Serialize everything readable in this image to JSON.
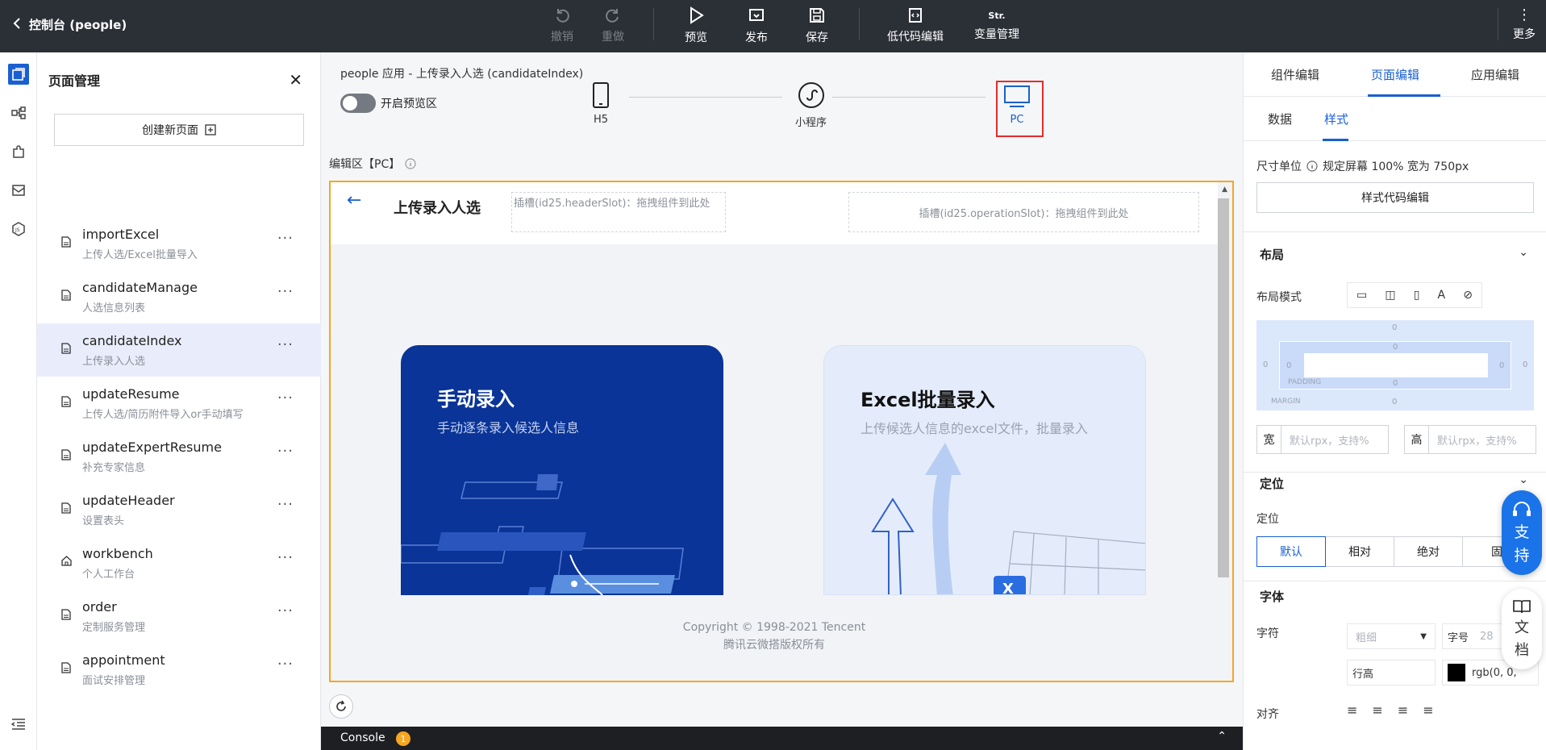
{
  "topbar": {
    "back_title": "控制台 (people)",
    "undo": "撤销",
    "redo": "重做",
    "preview": "预览",
    "publish": "发布",
    "save": "保存",
    "lowcode": "低代码编辑",
    "var_icon": "Str.",
    "variables": "变量管理",
    "more": "更多"
  },
  "page_panel": {
    "title": "页面管理",
    "create": "创建新页面",
    "pages": [
      {
        "name": "importExcel",
        "desc": "上传人选/Excel批量导入",
        "icon": "file-icon",
        "active": false
      },
      {
        "name": "candidateManage",
        "desc": "人选信息列表",
        "icon": "file-icon",
        "active": false
      },
      {
        "name": "candidateIndex",
        "desc": "上传录入人选",
        "icon": "file-icon",
        "active": true
      },
      {
        "name": "updateResume",
        "desc": "上传人选/简历附件导入or手动填写",
        "icon": "file-icon",
        "active": false
      },
      {
        "name": "updateExpertResume",
        "desc": "补充专家信息",
        "icon": "file-icon",
        "active": false
      },
      {
        "name": "updateHeader",
        "desc": "设置表头",
        "icon": "file-icon",
        "active": false
      },
      {
        "name": "workbench",
        "desc": "个人工作台",
        "icon": "home-icon",
        "active": false
      },
      {
        "name": "order",
        "desc": "定制服务管理",
        "icon": "file-icon",
        "active": false
      },
      {
        "name": "appointment",
        "desc": "面试安排管理",
        "icon": "file-icon",
        "active": false
      }
    ]
  },
  "editor": {
    "app_title": "people 应用 - 上传录入人选 (candidateIndex)",
    "preview_toggle": "开启预览区",
    "devices": {
      "h5": "H5",
      "mini": "小程序",
      "pc": "PC"
    },
    "edit_label": "编辑区【PC】",
    "canvas": {
      "title": "上传录入人选",
      "header_slot": "插槽(id25.headerSlot)：拖拽组件到此处",
      "operation_slot": "插槽(id25.operationSlot)：拖拽组件到此处",
      "card_manual_title": "手动录入",
      "card_manual_sub": "手动逐条录入候选人信息",
      "card_excel_title": "Excel批量录入",
      "card_excel_sub": "上传候选人信息的excel文件，批量录入",
      "copyright_1": "Copyright © 1998-2021 Tencent",
      "copyright_2": "腾讯云微搭版权所有"
    }
  },
  "console": {
    "label": "Console",
    "badge": "1"
  },
  "right_panel": {
    "tabs": [
      "组件编辑",
      "页面编辑",
      "应用编辑"
    ],
    "subtabs": [
      "数据",
      "样式"
    ],
    "size_unit": "尺寸单位",
    "size_unit_value": "规定屏幕 100% 宽为 750px",
    "style_code_btn": "样式代码编辑",
    "layout_title": "布局",
    "layout_mode": "布局模式",
    "box": {
      "margin_label": "MARGIN",
      "padding_label": "PADDING",
      "zero": "0"
    },
    "width_label": "宽",
    "width_placeholder": "默认rpx，支持%",
    "height_label": "高",
    "height_placeholder": "默认rpx，支持%",
    "position_title": "定位",
    "position_label": "定位",
    "position_options": [
      "默认",
      "相对",
      "绝对",
      "固"
    ],
    "font_title": "字体",
    "font_char": "字符",
    "font_weight": "粗细",
    "font_size": "字号",
    "font_size_val": "28",
    "line_height": "行高",
    "color_val": "rgb(0, 0,",
    "align": "对齐",
    "support": [
      "支",
      "持"
    ],
    "docs": [
      "文",
      "档"
    ]
  },
  "colors": {
    "accent": "#1a5fd1",
    "topbar": "#2b2f36",
    "canvas_border": "#f5a623",
    "highlight_box": "#e02d2d",
    "card_blue": "#0a3497"
  }
}
